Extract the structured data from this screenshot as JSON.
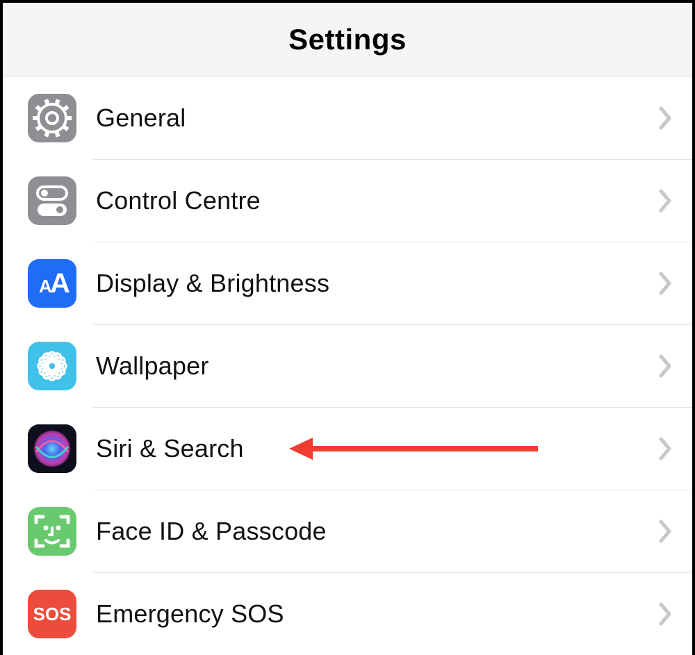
{
  "header": {
    "title": "Settings"
  },
  "rows": [
    {
      "key": "general",
      "label": "General",
      "icon": "gear",
      "bg": "#8e8e93",
      "highlighted": false
    },
    {
      "key": "control-centre",
      "label": "Control Centre",
      "icon": "toggles",
      "bg": "#8e8e93",
      "highlighted": false
    },
    {
      "key": "display",
      "label": "Display & Brightness",
      "icon": "aa",
      "bg": "#1f6df6",
      "highlighted": false
    },
    {
      "key": "wallpaper",
      "label": "Wallpaper",
      "icon": "flower",
      "bg": "#3fc1e9",
      "highlighted": false
    },
    {
      "key": "siri",
      "label": "Siri & Search",
      "icon": "siri",
      "bg": "#0d0f1c",
      "highlighted": true
    },
    {
      "key": "faceid",
      "label": "Face ID & Passcode",
      "icon": "face",
      "bg": "#69c96e",
      "highlighted": false
    },
    {
      "key": "sos",
      "label": "Emergency SOS",
      "icon": "sos",
      "bg": "#ed4b3b",
      "highlighted": false
    }
  ],
  "colors": {
    "chevron": "#c7c7cc",
    "arrow": "#f13d2f"
  }
}
